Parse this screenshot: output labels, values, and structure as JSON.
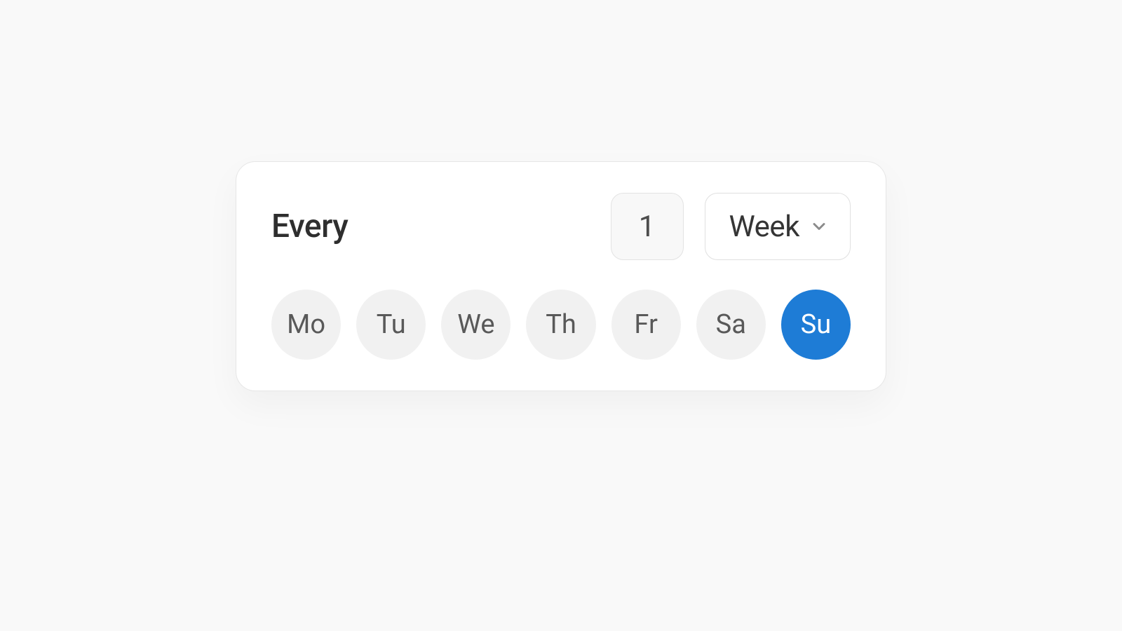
{
  "recurrence": {
    "every_label": "Every",
    "interval_value": "1",
    "unit_label": "Week",
    "days": [
      {
        "abbr": "Mo",
        "selected": false
      },
      {
        "abbr": "Tu",
        "selected": false
      },
      {
        "abbr": "We",
        "selected": false
      },
      {
        "abbr": "Th",
        "selected": false
      },
      {
        "abbr": "Fr",
        "selected": false
      },
      {
        "abbr": "Sa",
        "selected": false
      },
      {
        "abbr": "Su",
        "selected": true
      }
    ]
  },
  "colors": {
    "accent": "#1e7cd6",
    "card_bg": "#ffffff",
    "page_bg": "#f9f9f9",
    "chip_bg": "#f1f1f1"
  }
}
